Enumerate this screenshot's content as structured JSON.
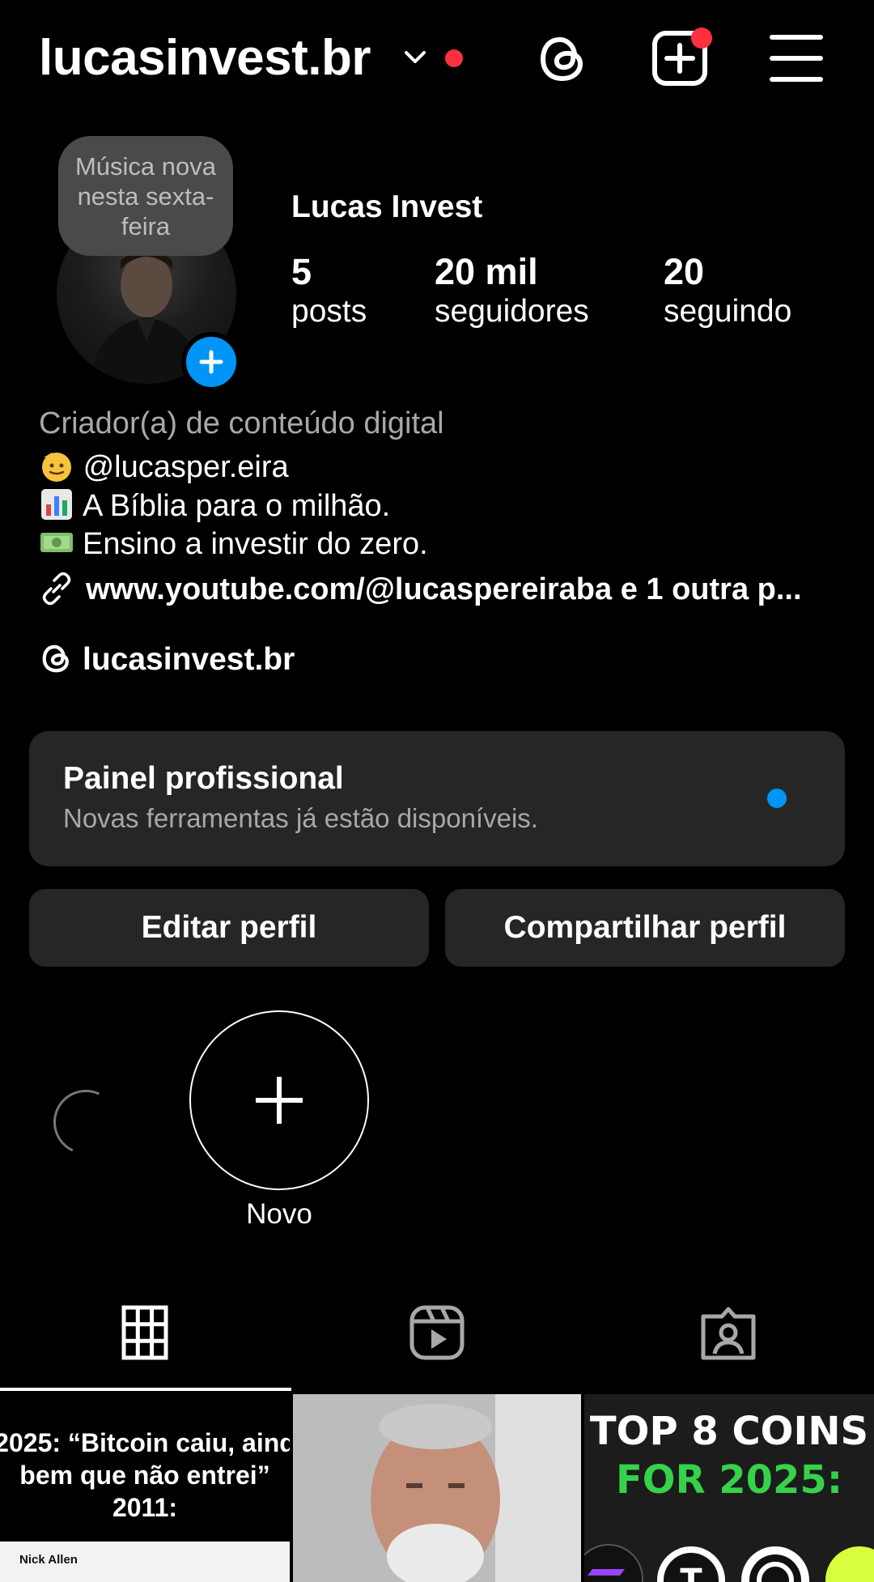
{
  "header": {
    "username": "lucasinvest.br",
    "icons": [
      "chevron-down-icon",
      "threads-icon",
      "create-icon",
      "menu-icon"
    ],
    "notification_color": "#ff3040"
  },
  "profile": {
    "note": "Música nova nesta sexta-feira",
    "full_name": "Lucas Invest",
    "stats": [
      {
        "value": "5",
        "label": "posts"
      },
      {
        "value": "20 mil",
        "label": "seguidores"
      },
      {
        "value": "20",
        "label": "seguindo"
      }
    ]
  },
  "bio": {
    "category": "Criador(a) de conteúdo digital",
    "lines": [
      "@lucasper.eira",
      "A Bíblia para o milhão.",
      "Ensino a investir do zero."
    ],
    "link": "www.youtube.com/@lucaspereiraba e 1 outra p...",
    "threads_handle": "lucasinvest.br"
  },
  "dashboard": {
    "title": "Painel profissional",
    "subtitle": "Novas ferramentas já estão disponíveis.",
    "accent": "#0095f6"
  },
  "actions": {
    "edit": "Editar perfil",
    "share": "Compartilhar perfil"
  },
  "highlights": {
    "new_label": "Novo"
  },
  "tabs": [
    "grid-icon",
    "reels-icon",
    "tagged-icon"
  ],
  "posts": [
    {
      "line1": "2025: “Bitcoin caiu, aind",
      "line2": "bem que não entrei”",
      "line3": "2011:",
      "author": "Nick Allen"
    },
    {
      "caption": ""
    },
    {
      "line1": "TOP 8 COINS",
      "line2": "FOR 2025:"
    }
  ]
}
